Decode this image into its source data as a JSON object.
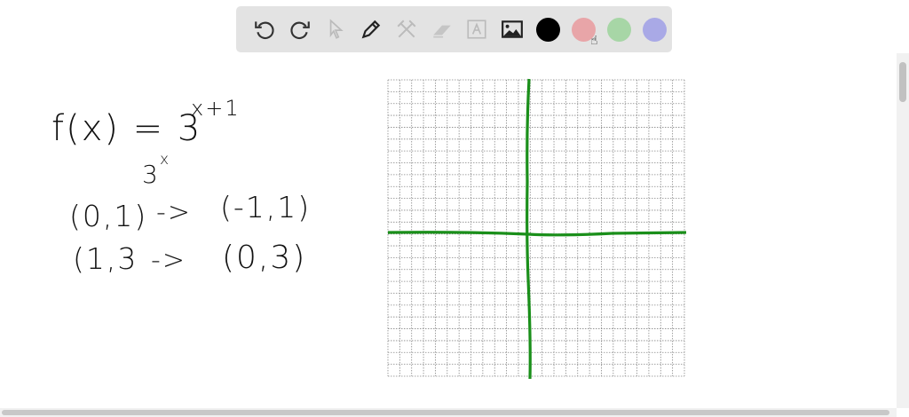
{
  "toolbar": {
    "tools": [
      "undo-icon",
      "redo-icon",
      "select-icon",
      "pen-icon",
      "tools-icon",
      "eraser-icon",
      "text-icon",
      "image-icon"
    ],
    "colors": [
      "#000000",
      "#e8a5a8",
      "#a7d6a6",
      "#a9a9e6"
    ]
  },
  "board": {
    "line1": "f(x) = 3",
    "line1_exp": "x+1",
    "line2": "3",
    "line2_exp": "x",
    "row1_left": "(0,1)",
    "row1_arrow": "->",
    "row1_right": "(-1,1)",
    "row2_left": "(1,3",
    "row2_arrow": "->",
    "row2_right": "(0,3)",
    "axis_color": "#1a8f1a"
  }
}
